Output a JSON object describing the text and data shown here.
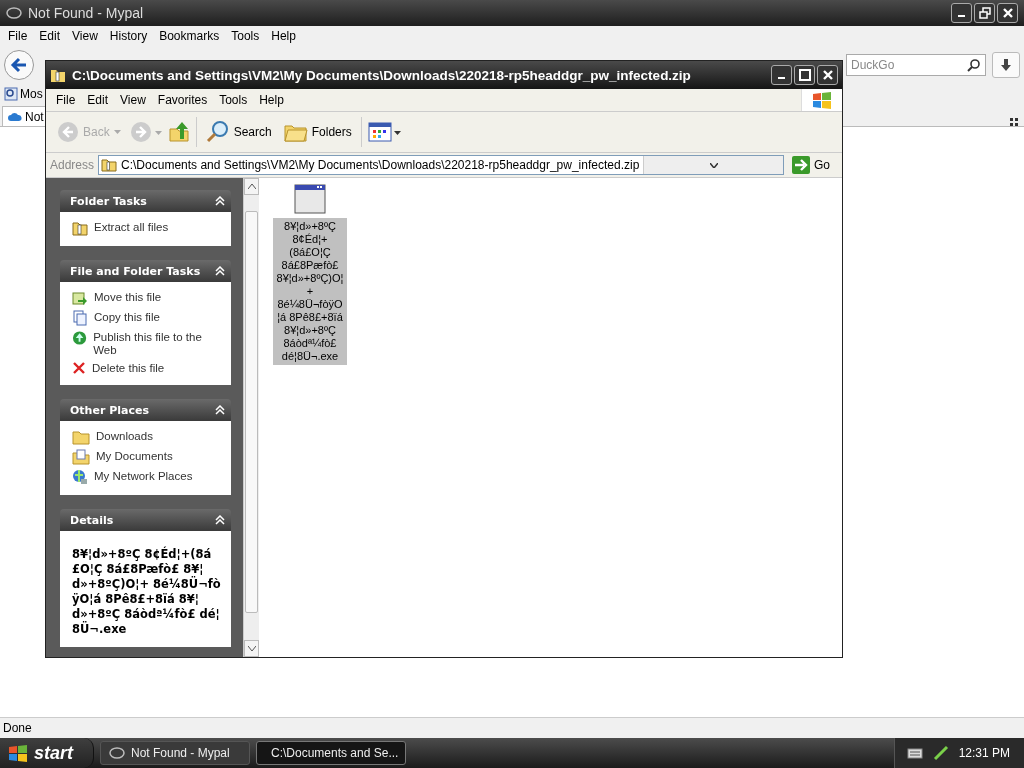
{
  "browser": {
    "title": "Not Found - Mypal",
    "menu": [
      "File",
      "Edit",
      "View",
      "History",
      "Bookmarks",
      "Tools",
      "Help"
    ],
    "search": {
      "value": "DuckGo"
    },
    "bookmarks": [
      "Mos"
    ],
    "tabs": [
      {
        "label": "Not",
        "selected": true
      }
    ],
    "status": "Done"
  },
  "explorer": {
    "title": "C:\\Documents and Settings\\VM2\\My Documents\\Downloads\\220218-rp5headdgr_pw_infected.zip",
    "menu": [
      "File",
      "Edit",
      "View",
      "Favorites",
      "Tools",
      "Help"
    ],
    "toolbar": {
      "back": {
        "label": "Back",
        "disabled": true
      },
      "search": "Search",
      "folders": "Folders"
    },
    "address": {
      "label": "Address",
      "value": "C:\\Documents and Settings\\VM2\\My Documents\\Downloads\\220218-rp5headdgr_pw_infected.zip",
      "go": "Go"
    },
    "panels": [
      {
        "title": "Folder Tasks",
        "expanded": true,
        "items": [
          "Extract all files"
        ]
      },
      {
        "title": "File and Folder Tasks",
        "expanded": true,
        "items": [
          "Move this file",
          "Copy this file",
          "Publish this file to the Web",
          "Delete this file"
        ]
      },
      {
        "title": "Other Places",
        "expanded": true,
        "items": [
          "Downloads",
          "My Documents",
          "My Network Places"
        ]
      },
      {
        "title": "Details",
        "expanded": true,
        "text": "8¥¦d»+8ºÇ 8¢Éd¦+(8á£O¦Ç 8á£8Pæfò£ 8¥¦d»+8ºÇ)O¦+ 8é¼8Ü¬fòÿO¦á 8Pê8£+8ïá 8¥¦d»+8ºÇ 8áòdª¼fò£ dé¦8Ü¬.exe"
      }
    ],
    "files": [
      {
        "name": "8¥¦d»+8ºÇ 8¢Éd¦+(8á£O¦Ç 8á£8Pæfò£ 8¥¦d»+8ºÇ)O¦+ 8é¼8Ü¬fòÿO ¦á 8Pê8£+8ïá 8¥¦d»+8ºÇ 8áòdª¼fò£ dé¦8Ü¬.exe",
        "selected": true
      }
    ]
  },
  "taskbar": {
    "start": "start",
    "tasks": [
      {
        "label": "Not Found - Mypal",
        "selected": false
      },
      {
        "label": "C:\\Documents and Se...",
        "selected": true
      }
    ],
    "clock": "12:31 PM"
  }
}
